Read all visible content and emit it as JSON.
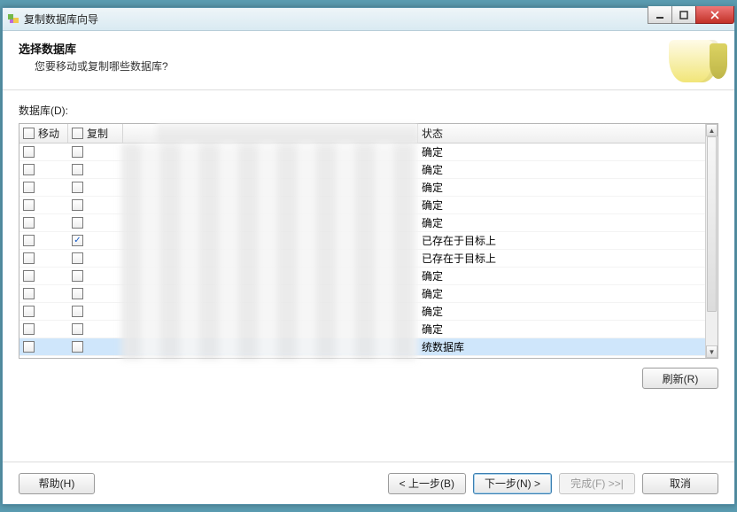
{
  "window": {
    "title": "复制数据库向导"
  },
  "header": {
    "title": "选择数据库",
    "subtitle": "您要移动或复制哪些数据库?"
  },
  "table": {
    "label": "数据库(D):",
    "columns": {
      "move": "移动",
      "copy": "复制",
      "status": "状态"
    },
    "rows": [
      {
        "move": false,
        "copy": false,
        "status": "确定"
      },
      {
        "move": false,
        "copy": false,
        "status": "确定"
      },
      {
        "move": false,
        "copy": false,
        "status": "确定"
      },
      {
        "move": false,
        "copy": false,
        "status": "确定"
      },
      {
        "move": false,
        "copy": false,
        "status": "确定"
      },
      {
        "move": false,
        "copy": true,
        "status": "已存在于目标上"
      },
      {
        "move": false,
        "copy": false,
        "status": "已存在于目标上"
      },
      {
        "move": false,
        "copy": false,
        "status": "确定"
      },
      {
        "move": false,
        "copy": false,
        "status": "确定"
      },
      {
        "move": false,
        "copy": false,
        "status": "确定"
      },
      {
        "move": false,
        "copy": false,
        "status": "确定"
      },
      {
        "move": false,
        "copy": false,
        "status": "统数据库",
        "selected": true
      }
    ]
  },
  "buttons": {
    "refresh": "刷新(R)",
    "help": "帮助(H)",
    "back": "< 上一步(B)",
    "next": "下一步(N) >",
    "finish": "完成(F) >>|",
    "cancel": "取消"
  },
  "layout": {
    "col_move_w": 55,
    "col_copy_w": 62,
    "col_hidden_w": 333,
    "col_status_w": 330
  }
}
